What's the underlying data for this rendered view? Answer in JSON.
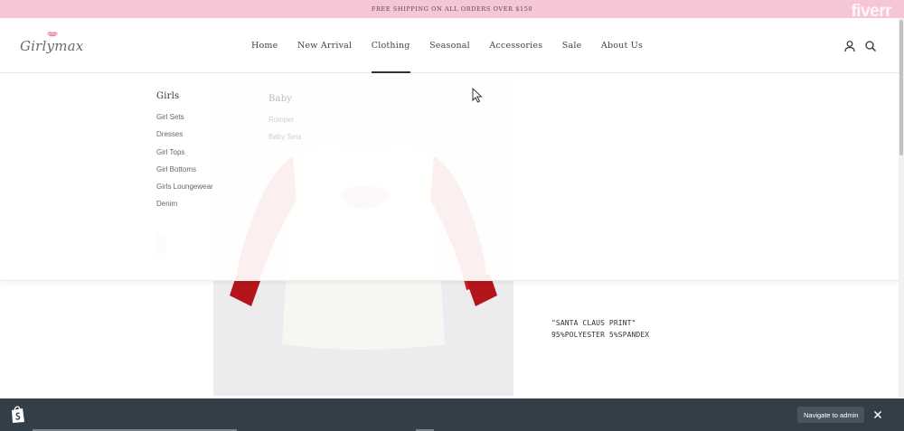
{
  "announcement": {
    "text": "FREE SHIPPING ON ALL ORDERS OVER $150"
  },
  "watermark": "fiverr",
  "brand": {
    "logo_text": "Girlymax",
    "accent_color": "#f7c5d8"
  },
  "nav": {
    "items": [
      {
        "label": "Home"
      },
      {
        "label": "New Arrival"
      },
      {
        "label": "Clothing",
        "active": true
      },
      {
        "label": "Seasonal"
      },
      {
        "label": "Accessories"
      },
      {
        "label": "Sale"
      },
      {
        "label": "About Us"
      }
    ],
    "icons": [
      "account-icon",
      "search-icon"
    ]
  },
  "mega_menu": {
    "girls": {
      "title": "Girls",
      "links": [
        "Girl Sets",
        "Dresses",
        "Girl Tops",
        "Girl Bottoms",
        "Girls Loungewear",
        "Denim"
      ]
    },
    "baby": {
      "title": "Baby",
      "links": [
        "Romper",
        "Baby Sets"
      ]
    }
  },
  "product": {
    "description_line1": "\"SANTA CLAUS PRINT\"",
    "description_line2": "95%POLYESTER 5%SPANDEX"
  },
  "admin_bar": {
    "navigate_label": "Navigate to admin",
    "bg_color": "#333f48"
  }
}
